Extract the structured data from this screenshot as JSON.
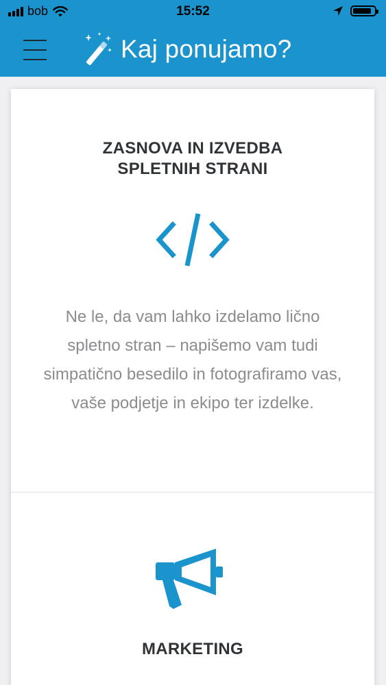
{
  "status_bar": {
    "carrier": "bob",
    "time": "15:52",
    "battery_level": 0.85
  },
  "header": {
    "title": "Kaj ponujamo?",
    "menu_icon": "hamburger-menu-icon",
    "title_icon": "magic-wand-icon"
  },
  "services": [
    {
      "title_line1": "ZASNOVA IN IZVEDBA",
      "title_line2": "SPLETNIH STRANI",
      "icon": "code-brackets-icon",
      "description": "Ne le, da vam lahko izdelamo lično spletno stran – napišemo vam tudi simpatično besedilo in fotografiramo vas, vaše podjetje in ekipo ter izdelke."
    },
    {
      "title_line1": "MARKETING",
      "icon": "megaphone-icon"
    }
  ],
  "colors": {
    "brand": "#1b93cd",
    "icon_blue": "#1b93cd",
    "heading": "#303437",
    "body_text": "#8a8c8f"
  }
}
